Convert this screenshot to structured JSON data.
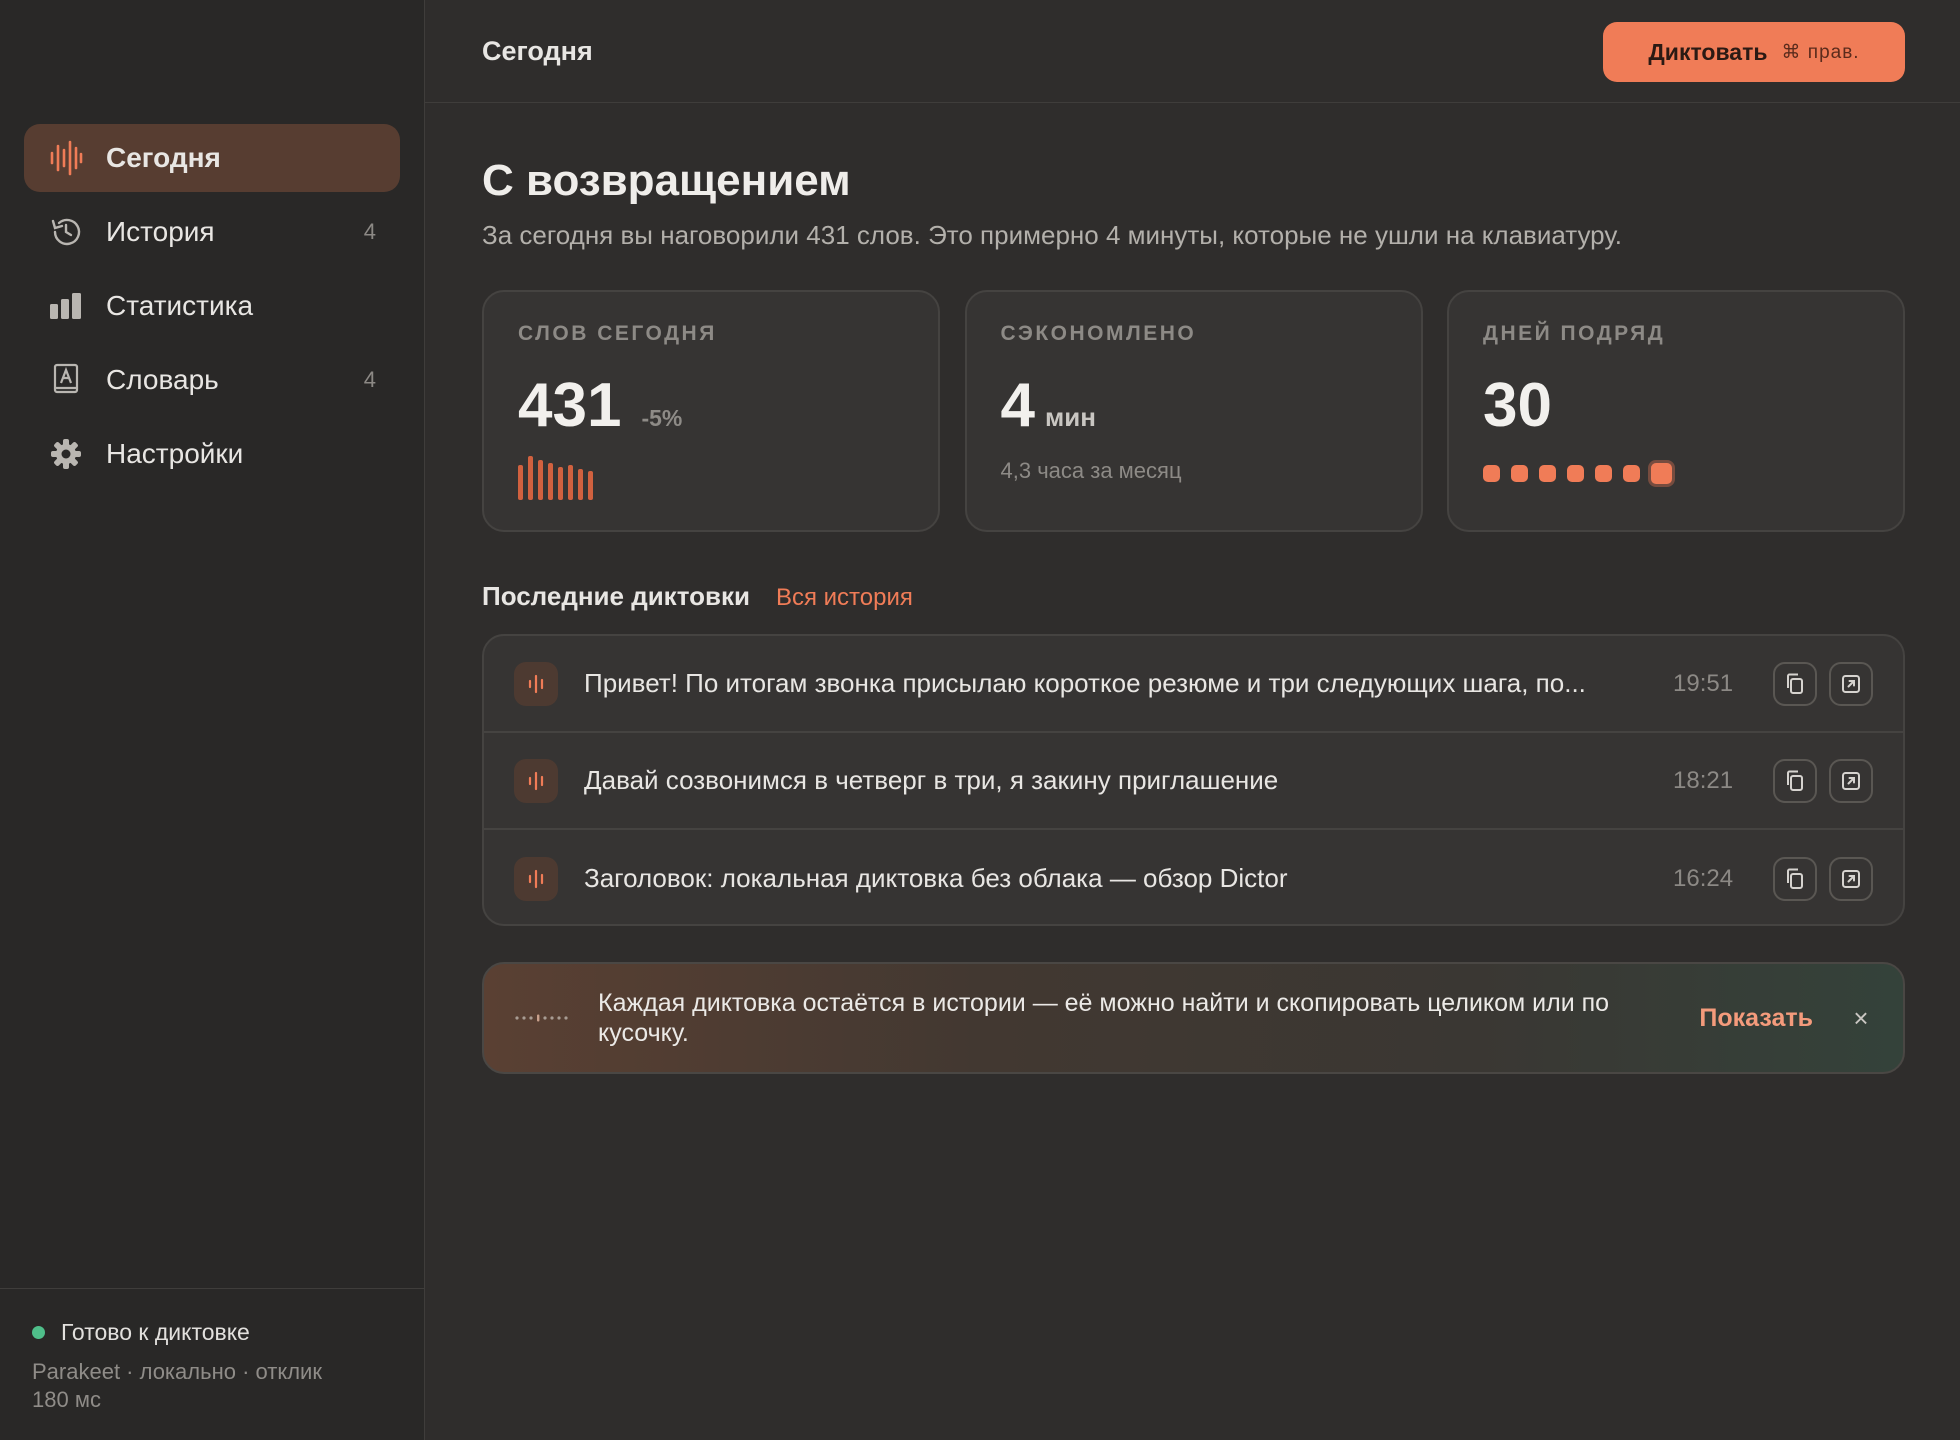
{
  "sidebar": {
    "items": [
      {
        "label": "Сегодня",
        "icon": "waveform-icon",
        "active": true
      },
      {
        "label": "История",
        "icon": "history-icon",
        "count": "4"
      },
      {
        "label": "Статистика",
        "icon": "bar-chart-icon"
      },
      {
        "label": "Словарь",
        "icon": "dictionary-icon",
        "count": "4"
      },
      {
        "label": "Настройки",
        "icon": "gear-icon"
      }
    ],
    "status": {
      "title": "Готово к диктовке",
      "details": "Parakeet · локально · отклик 180 мс",
      "color": "#4fbf8a"
    }
  },
  "header": {
    "title": "Сегодня",
    "dictate_label": "Диктовать",
    "dictate_shortcut": "⌘ прав."
  },
  "main": {
    "welcome": "С возвращением",
    "subtitle": "За сегодня вы наговорили 431 слов. Это примерно 4 минуты, которые не ушли на клавиатуру.",
    "cards": [
      {
        "label": "СЛОВ СЕГОДНЯ",
        "value": "431",
        "delta": "-5%",
        "bar_levels": [
          0.8,
          1.0,
          0.9,
          0.85,
          0.75,
          0.8,
          0.7,
          0.65
        ]
      },
      {
        "label": "СЭКОНОМЛЕНО",
        "value": "4",
        "unit": "мин",
        "note": "4,3 часа за месяц"
      },
      {
        "label": "ДНЕЙ ПОДРЯД",
        "value": "30",
        "streak_dots": 7
      }
    ],
    "recent": {
      "title": "Последние диктовки",
      "link": "Вся история",
      "items": [
        {
          "text": "Привет! По итогам звонка присылаю короткое резюме и три следующих шага, по...",
          "time": "19:51"
        },
        {
          "text": "Давай созвонимся в четверг в три, я закину приглашение",
          "time": "18:21"
        },
        {
          "text": "Заголовок: локальная диктовка без облака — обзор Dictor",
          "time": "16:24"
        }
      ]
    },
    "banner": {
      "text": "Каждая диктовка остаётся в истории — её можно найти и скопировать целиком или по кусочку.",
      "action": "Показать",
      "close": "×"
    }
  },
  "colors": {
    "accent": "#f07c57",
    "background": "#2f2d2c",
    "sidebar": "#292827",
    "card": "#363433"
  }
}
